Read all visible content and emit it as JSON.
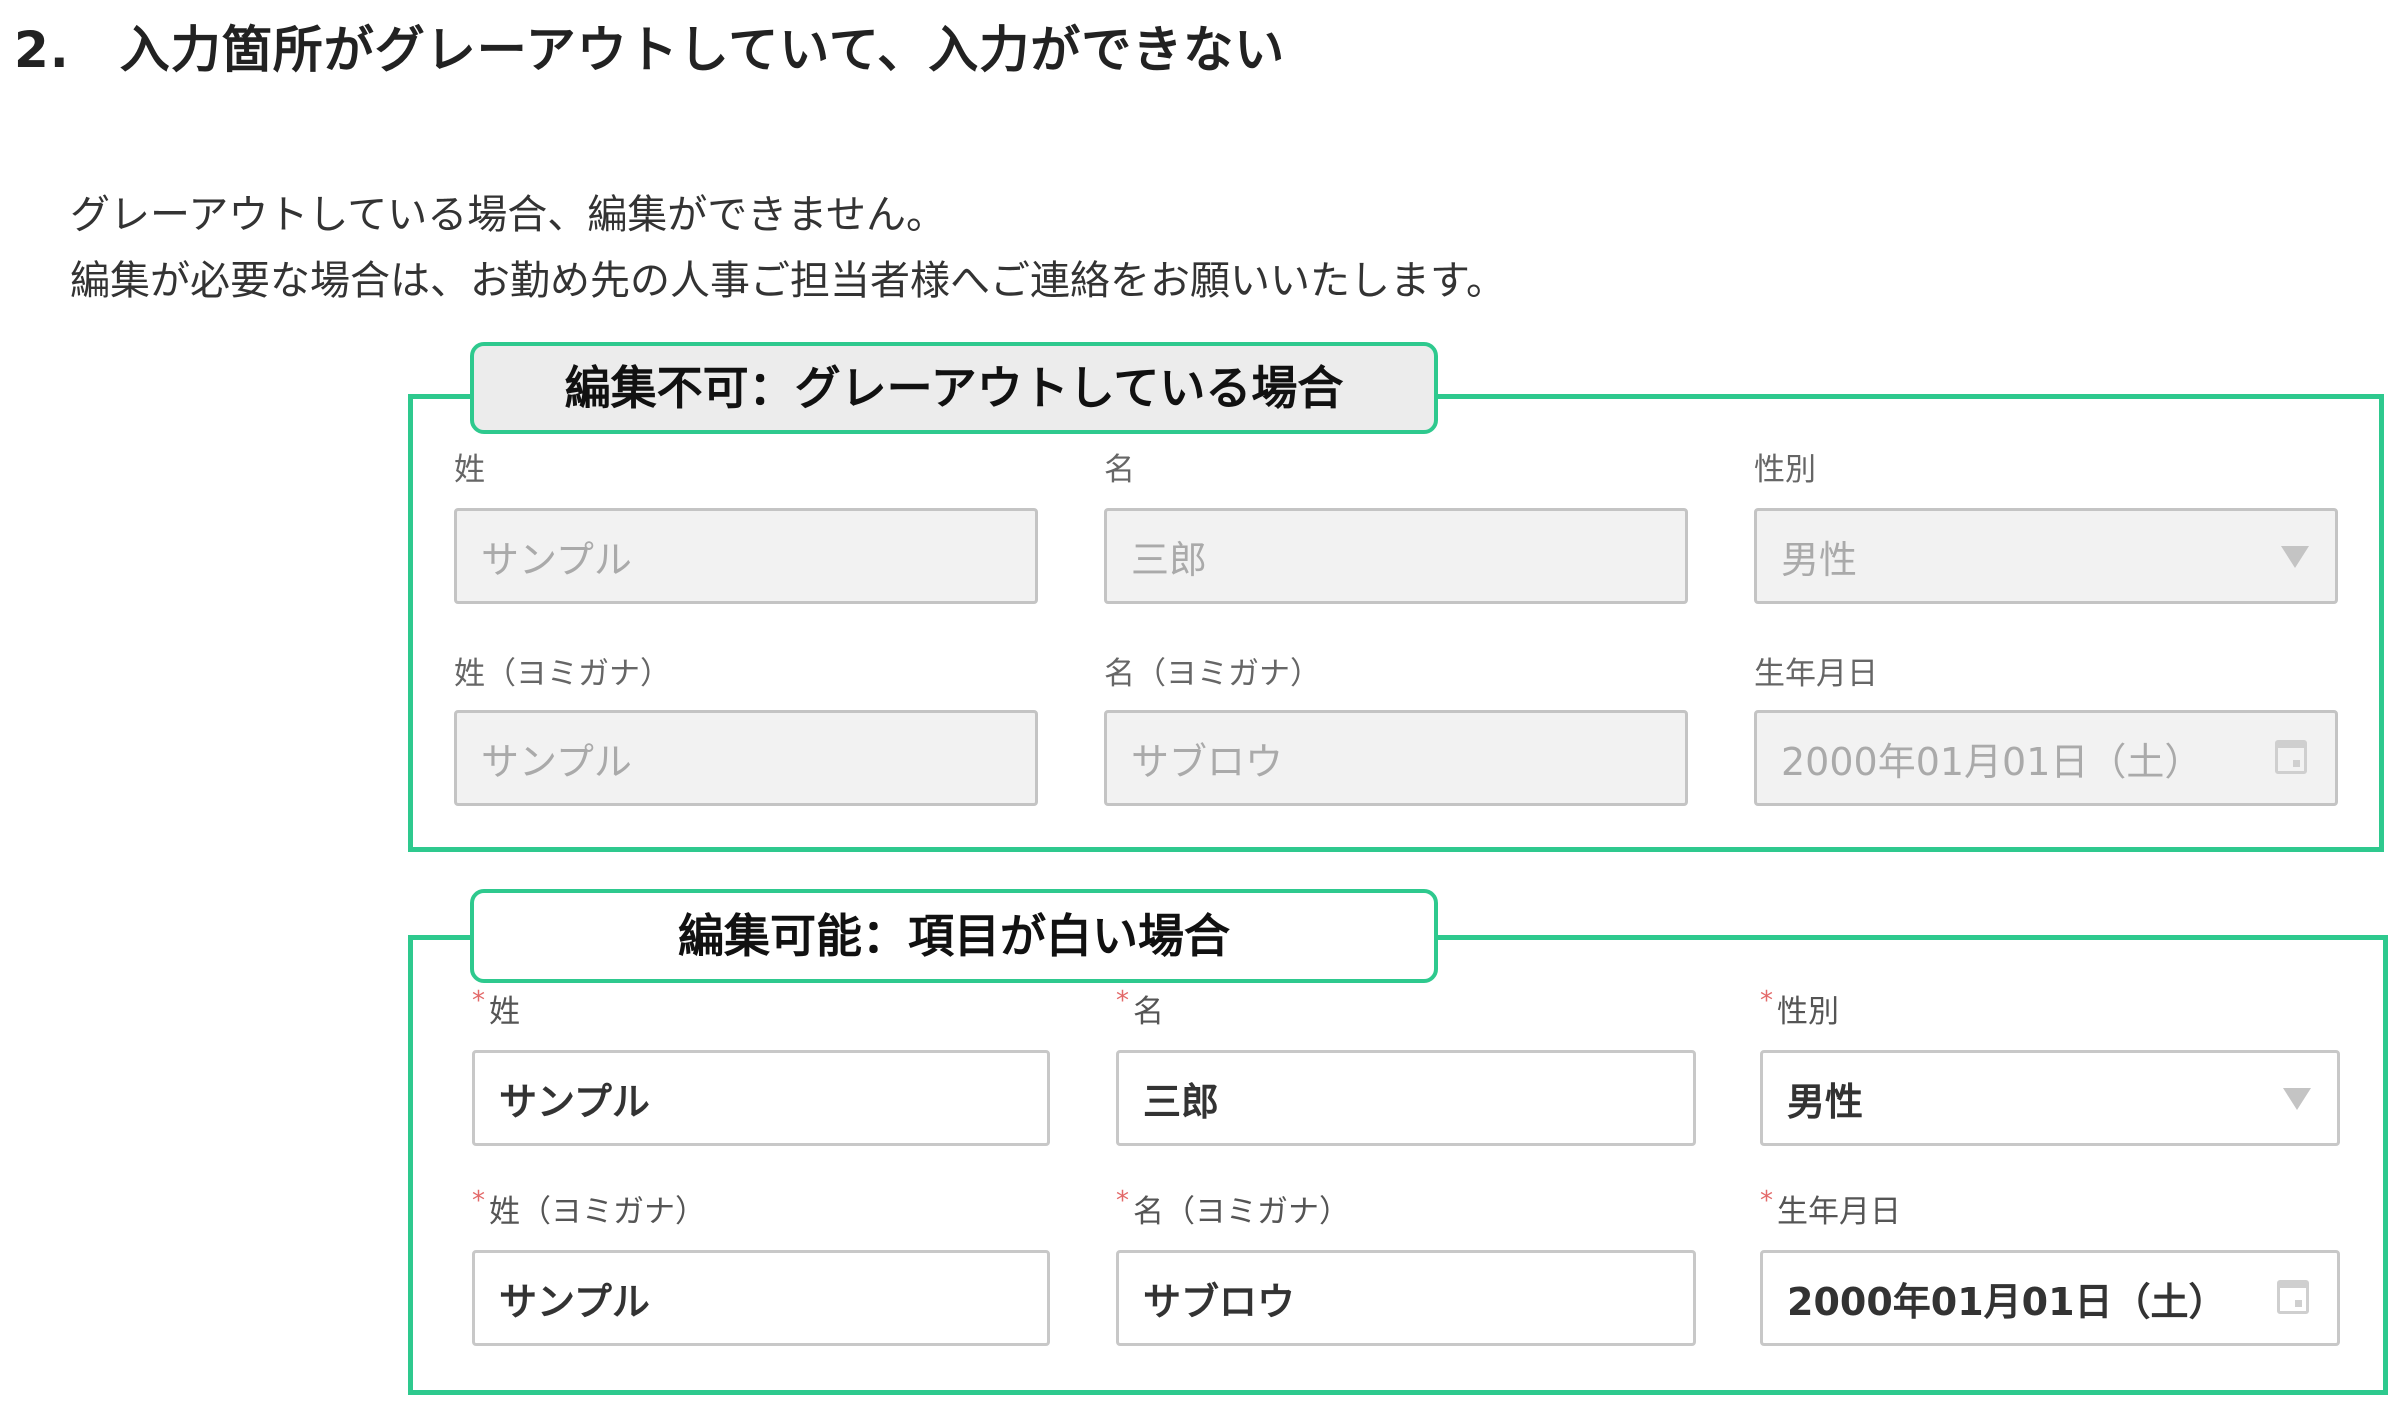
{
  "heading": {
    "number": "2.",
    "text": "入力箇所がグレーアウトしていて、入力ができない"
  },
  "description": {
    "line1": "グレーアウトしている場合、編集ができません。",
    "line2": "編集が必要な場合は、お勤め先の人事ご担当者様へご連絡をお願いいたします。"
  },
  "disabled_panel": {
    "title": "編集不可：グレーアウトしている場合",
    "labels": {
      "last_name": "姓",
      "first_name": "名",
      "gender": "性別",
      "last_name_kana": "姓（ヨミガナ）",
      "first_name_kana": "名（ヨミガナ）",
      "birthdate": "生年月日"
    },
    "values": {
      "last_name": "サンプル",
      "first_name": "三郎",
      "gender": "男性",
      "last_name_kana": "サンプル",
      "first_name_kana": "サブロウ",
      "birthdate": "2000年01月01日（土）"
    }
  },
  "enabled_panel": {
    "title": "編集可能：項目が白い場合",
    "required_mark": "*",
    "labels": {
      "last_name": "姓",
      "first_name": "名",
      "gender": "性別",
      "last_name_kana": "姓（ヨミガナ）",
      "first_name_kana": "名（ヨミガナ）",
      "birthdate": "生年月日"
    },
    "values": {
      "last_name": "サンプル",
      "first_name": "三郎",
      "gender": "男性",
      "last_name_kana": "サンプル",
      "first_name_kana": "サブロウ",
      "birthdate": "2000年01月01日（土）"
    }
  },
  "colors": {
    "accent_green": "#2ec98e",
    "disabled_bg": "#f2f2f2",
    "required_red": "#e36a6a"
  },
  "icons": {
    "dropdown": "caret-down-icon",
    "calendar": "calendar-icon"
  }
}
